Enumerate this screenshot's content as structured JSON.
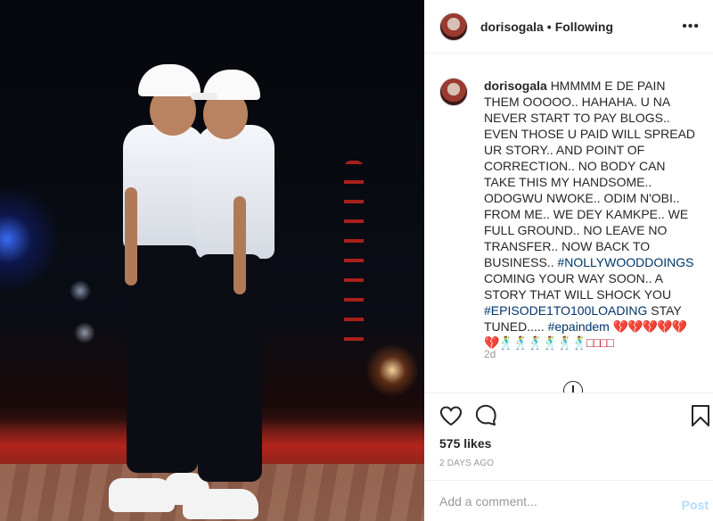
{
  "post": {
    "username": "dorisogala",
    "separator": "•",
    "follow_status": "Following",
    "more_label": "•••",
    "caption": {
      "username": "dorisogala",
      "text_part1": "HMMMM E DE PAIN THEM OOOOO.. HAHAHA. U NA NEVER START TO PAY BLOGS.. EVEN THOSE U PAID WILL SPREAD UR STORY.. AND POINT OF CORRECTION.. NO BODY CAN TAKE THIS MY HANDSOME.. ODOGWU NWOKE.. ODIM N'OBI.. FROM ME.. WE DEY KAMKPE.. WE FULL GROUND.. NO LEAVE NO TRANSFER.. NOW BACK TO BUSINESS..",
      "hashtag1": "#NOLLYWOODDOINGS",
      "text_part2": "COMING YOUR WAY SOON.. A STORY THAT WILL SHOCK YOU",
      "hashtag2": "#EPISODE1TO100LOADING",
      "text_part3": "STAY TUNED.....",
      "hashtag3": "#epaindem",
      "emojis": "💔💔💔💔💔💔🕺🕺🕺🕺🕺🕺□□□□",
      "age": "2d"
    },
    "likes": "575 likes",
    "timestamp": "2 DAYS AGO",
    "comment_placeholder": "Add a comment...",
    "post_label": "Post"
  },
  "icons": {
    "like": "heart-icon",
    "comment": "comment-icon",
    "save": "bookmark-icon",
    "load_more": "plus-circle-icon",
    "more": "more-options-icon"
  },
  "colors": {
    "hashtag": "#003569",
    "post_disabled": "#b3dbff",
    "secondary_text": "#999999"
  }
}
